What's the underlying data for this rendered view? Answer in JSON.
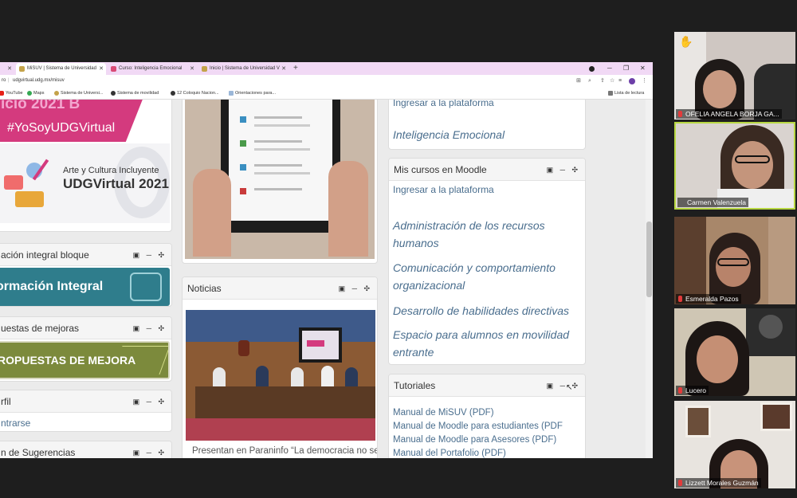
{
  "browser": {
    "tabs": [
      {
        "label": "",
        "color": "#e36ba8"
      },
      {
        "label": "MiSUV | Sistema de Universidad",
        "color": "#c4a34a"
      },
      {
        "label": "Curso: Inteligencia Emocional",
        "color": "#d94a76"
      },
      {
        "label": "Inicio | Sistema de Universidad V",
        "color": "#c4a34a"
      }
    ],
    "url": "udgvirtual.udg.mx/misuv",
    "url_prefix": "ro",
    "bookmarks": [
      {
        "label": "YouTube",
        "icon": "youtube-icon",
        "color": "#e62117"
      },
      {
        "label": "Maps",
        "icon": "maps-icon",
        "color": "#34a853"
      },
      {
        "label": "Sistema de Universi...",
        "icon": "site-icon",
        "color": "#c4a34a"
      },
      {
        "label": "Sistema de movilidad",
        "icon": "globe-icon",
        "color": "#333333"
      },
      {
        "label": "12 Coloquio Nacion...",
        "icon": "globe-icon",
        "color": "#333333"
      },
      {
        "label": "Orientaciones para...",
        "icon": "doc-icon",
        "color": "#9bb7d8"
      }
    ],
    "reading_list": "Lista de lectura"
  },
  "left_column": {
    "top_banner_line1": "icio 2021 B",
    "top_banner_line2": "#YoSoyUDGVirtual",
    "arte_title": "Arte y Cultura Incluyente",
    "arte_subtitle": "UDGVirtual 2021",
    "formacion_header": "ación integral bloque",
    "formacion_banner": "ormación Integral",
    "propuestas_header": "uestas de mejoras",
    "propuestas_banner": "ROPUESTAS DE MEJORA",
    "perfil_header": "rfil",
    "perfil_link": "ntrarse",
    "sugerencias_header": "n de Sugerencias"
  },
  "middle_column": {
    "noticias_header": "Noticias",
    "news_caption": "Presentan en Paraninfo “La democracia no se"
  },
  "right_column": {
    "top_link": "Ingresar a la plataforma",
    "top_course": "Inteligencia Emocional",
    "moodle_header": "Mis cursos en Moodle",
    "moodle_link": "Ingresar a la plataforma",
    "courses": [
      "Administración de los recursos humanos",
      "Comunicación y comportamiento organizacional",
      "Desarrollo de habilidades directivas",
      "Espacio para alumnos en movilidad entrante"
    ],
    "tutoriales_header": "Tutoriales",
    "tutorials": [
      "Manual de MiSUV (PDF)",
      "Manual de Moodle para estudiantes (PDF",
      "Manual de Moodle para Asesores (PDF)",
      "Manual del Portafolio (PDF)"
    ]
  },
  "participants": [
    {
      "name": "OFELIA ANGELA BORJA GA...",
      "speaking": false,
      "hand_raised": true
    },
    {
      "name": "Carmen Valenzuela",
      "speaking": true,
      "hand_raised": false
    },
    {
      "name": "Esmeralda Pazos",
      "speaking": false,
      "hand_raised": false
    },
    {
      "name": "Lucero",
      "speaking": false,
      "hand_raised": false
    },
    {
      "name": "Lizzett Morales Guzmán",
      "speaking": false,
      "hand_raised": false
    }
  ],
  "colors": {
    "speaker_border": "#b8d843",
    "link": "#4a6e8e",
    "banner_magenta": "#d43a7e",
    "banner_teal": "#2f7d8c",
    "banner_olive": "#7c8a3c"
  }
}
